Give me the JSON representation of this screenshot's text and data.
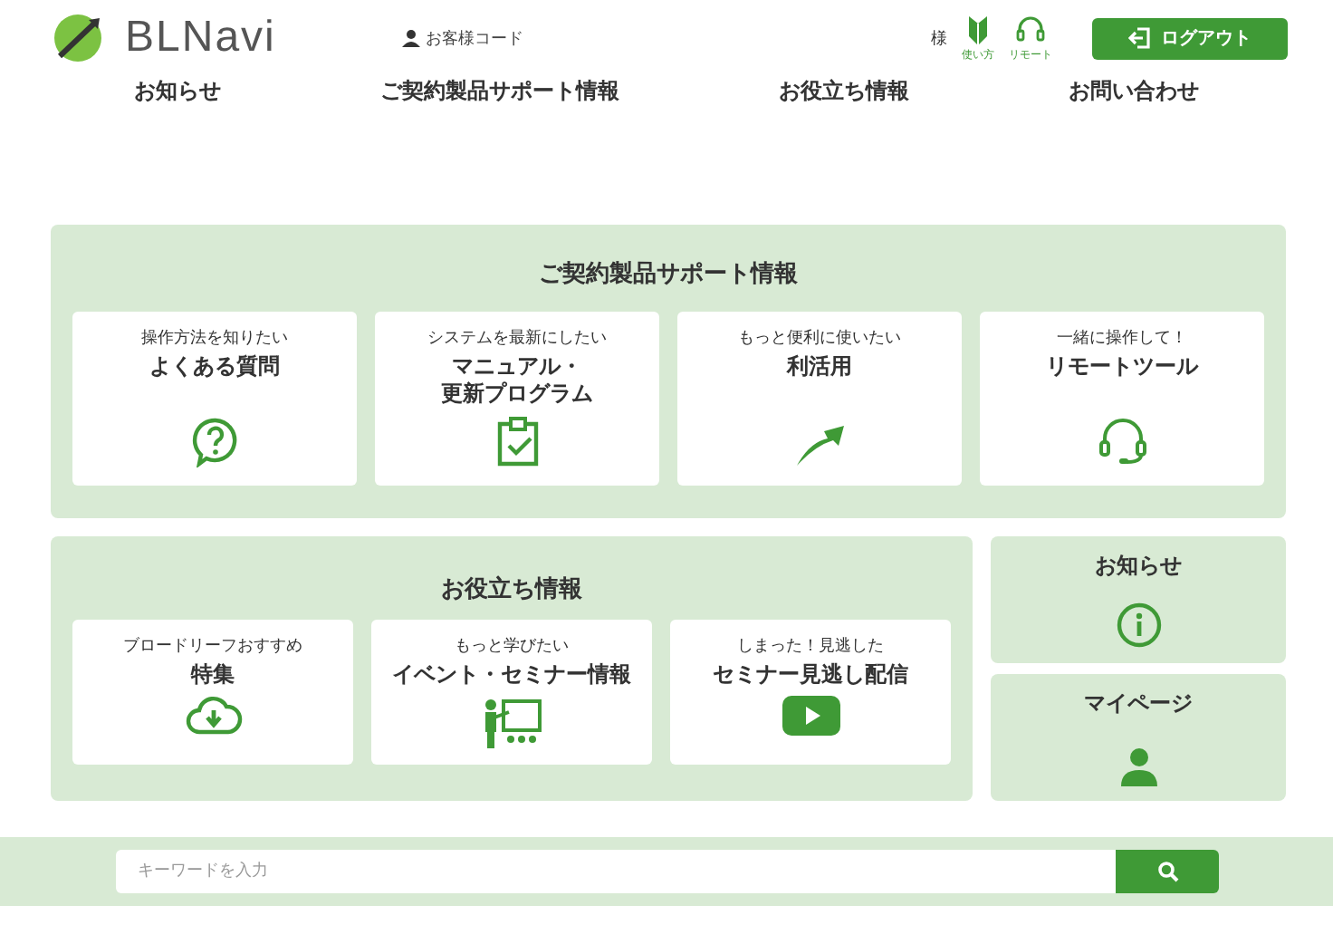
{
  "header": {
    "logo_text": "BLNavi",
    "customer_code": "お客様コード",
    "honorific": "様",
    "shortcuts": [
      "使い方",
      "リモート"
    ],
    "logout": "ログアウト"
  },
  "nav": [
    "お知らせ",
    "ご契約製品サポート情報",
    "お役立ち情報",
    "お問い合わせ"
  ],
  "support": {
    "title": "ご契約製品サポート情報",
    "cards": [
      {
        "caption": "操作方法を知りたい",
        "title_lines": [
          "よくある質問"
        ]
      },
      {
        "caption": "システムを最新にしたい",
        "title_lines": [
          "マニュアル・",
          "更新プログラム"
        ]
      },
      {
        "caption": "もっと便利に使いたい",
        "title_lines": [
          "利活用"
        ]
      },
      {
        "caption": "一緒に操作して！",
        "title_lines": [
          "リモートツール"
        ]
      }
    ]
  },
  "useful": {
    "title": "お役立ち情報",
    "cards": [
      {
        "caption": "ブロードリーフおすすめ",
        "title": "特集"
      },
      {
        "caption": "もっと学びたい",
        "title": "イベント・セミナー情報"
      },
      {
        "caption": "しまった！見逃した",
        "title": "セミナー見逃し配信"
      }
    ]
  },
  "side_cards": [
    {
      "title": "お知らせ"
    },
    {
      "title": "マイページ"
    }
  ],
  "search": {
    "placeholder": "キーワードを入力"
  }
}
